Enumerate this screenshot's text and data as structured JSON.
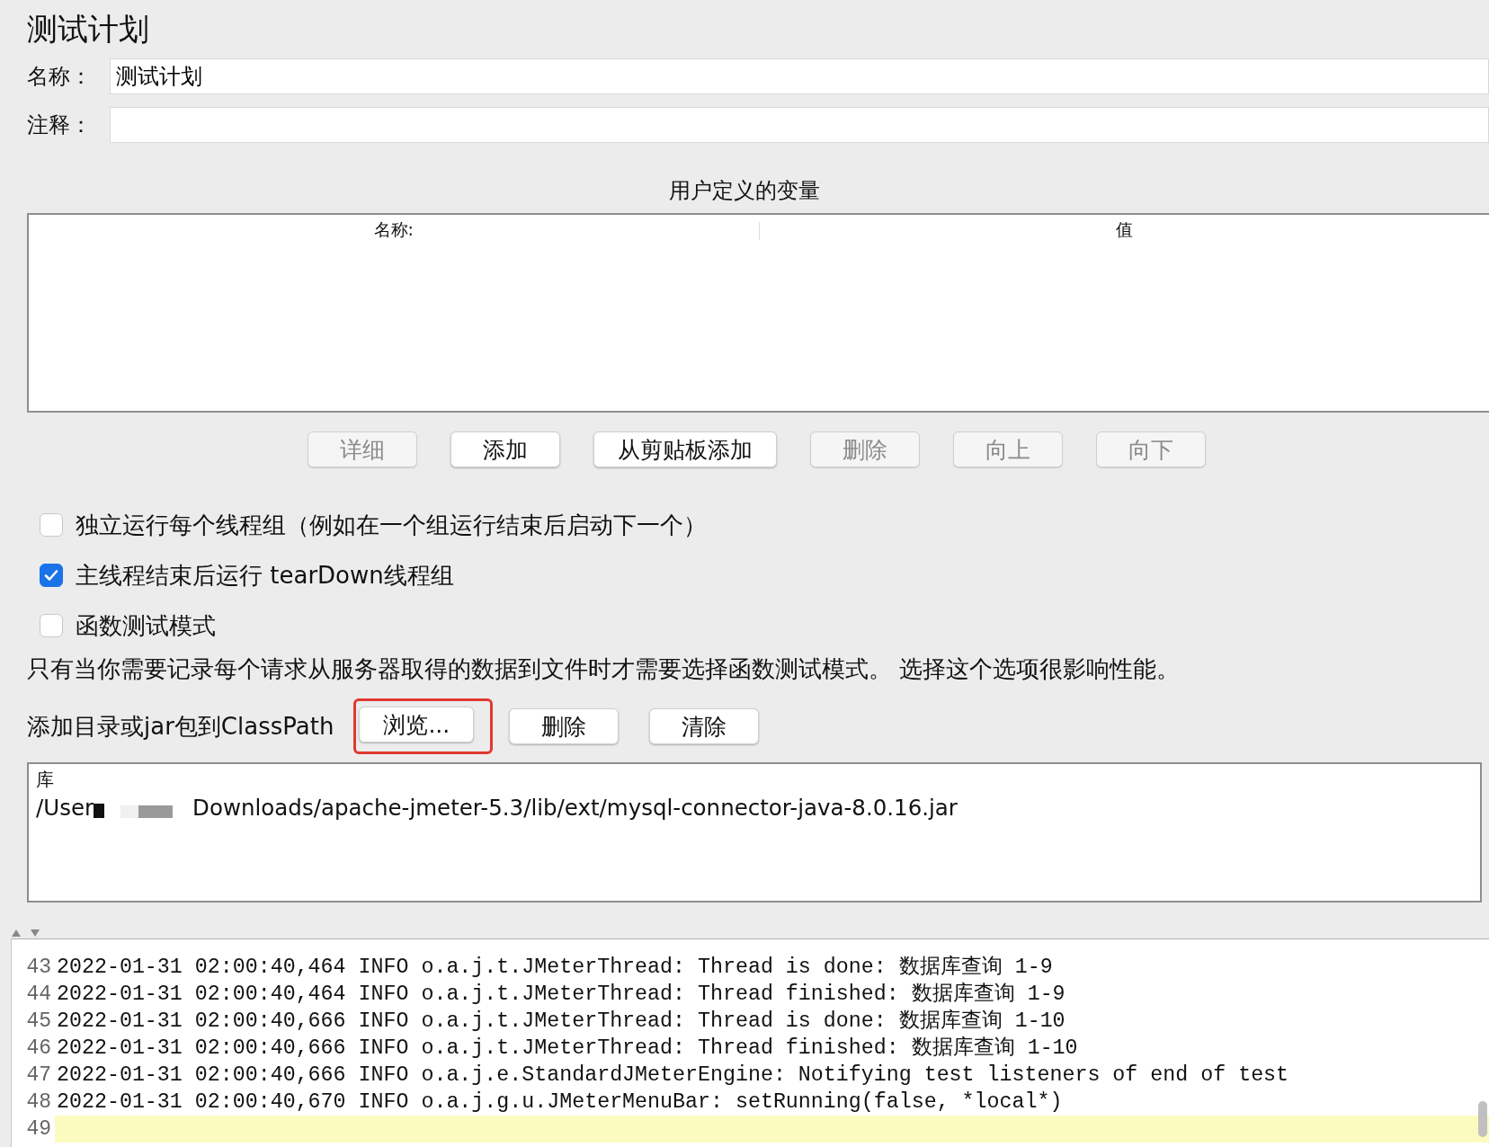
{
  "title": "测试计划",
  "fields": [
    {
      "label": "名称：",
      "value": "测试计划"
    },
    {
      "label": "注释："
    }
  ],
  "variables": {
    "title": "用户定义的变量",
    "columns": [
      "名称:",
      "值"
    ]
  },
  "variable_buttons": [
    {
      "label": "详细",
      "disabled": true
    },
    {
      "label": "添加",
      "disabled": false
    },
    {
      "label": "从剪贴板添加",
      "disabled": false
    },
    {
      "label": "删除",
      "disabled": true
    },
    {
      "label": "向上",
      "disabled": true
    },
    {
      "label": "向下",
      "disabled": true
    }
  ],
  "options": [
    {
      "label": "独立运行每个线程组（例如在一个组运行结束后启动下一个）",
      "checked": false
    },
    {
      "label": "主线程结束后运行 tearDown线程组",
      "checked": true
    },
    {
      "label": "函数测试模式",
      "checked": false
    }
  ],
  "note": "只有当你需要记录每个请求从服务器取得的数据到文件时才需要选择函数测试模式。 选择这个选项很影响性能。",
  "classpath": {
    "label": "添加目录或jar包到ClassPath",
    "buttons": [
      {
        "label": "浏览...",
        "highlighted": true
      },
      {
        "label": "删除",
        "highlighted": false
      },
      {
        "label": "清除",
        "highlighted": false
      }
    ]
  },
  "library": {
    "column": "库",
    "rows": [
      {
        "parts": [
          "/User",
          "Downloads/apache-jmeter-5.3/lib/ext/mysql-connector-java-8.0.16.jar"
        ]
      }
    ]
  },
  "log": [
    {
      "number": "43",
      "text": "2022-01-31 02:00:40,464 INFO o.a.j.t.JMeterThread: Thread is done: 数据库查询 1-9",
      "current": false
    },
    {
      "number": "44",
      "text": "2022-01-31 02:00:40,464 INFO o.a.j.t.JMeterThread: Thread finished: 数据库查询 1-9",
      "current": false
    },
    {
      "number": "45",
      "text": "2022-01-31 02:00:40,666 INFO o.a.j.t.JMeterThread: Thread is done: 数据库查询 1-10",
      "current": false
    },
    {
      "number": "46",
      "text": "2022-01-31 02:00:40,666 INFO o.a.j.t.JMeterThread: Thread finished: 数据库查询 1-10",
      "current": false
    },
    {
      "number": "47",
      "text": "2022-01-31 02:00:40,666 INFO o.a.j.e.StandardJMeterEngine: Notifying test listeners of end of test",
      "current": false
    },
    {
      "number": "48",
      "text": "2022-01-31 02:00:40,670 INFO o.a.j.g.u.JMeterMenuBar: setRunning(false, *local*)",
      "current": false
    },
    {
      "number": "49",
      "current": true
    }
  ]
}
